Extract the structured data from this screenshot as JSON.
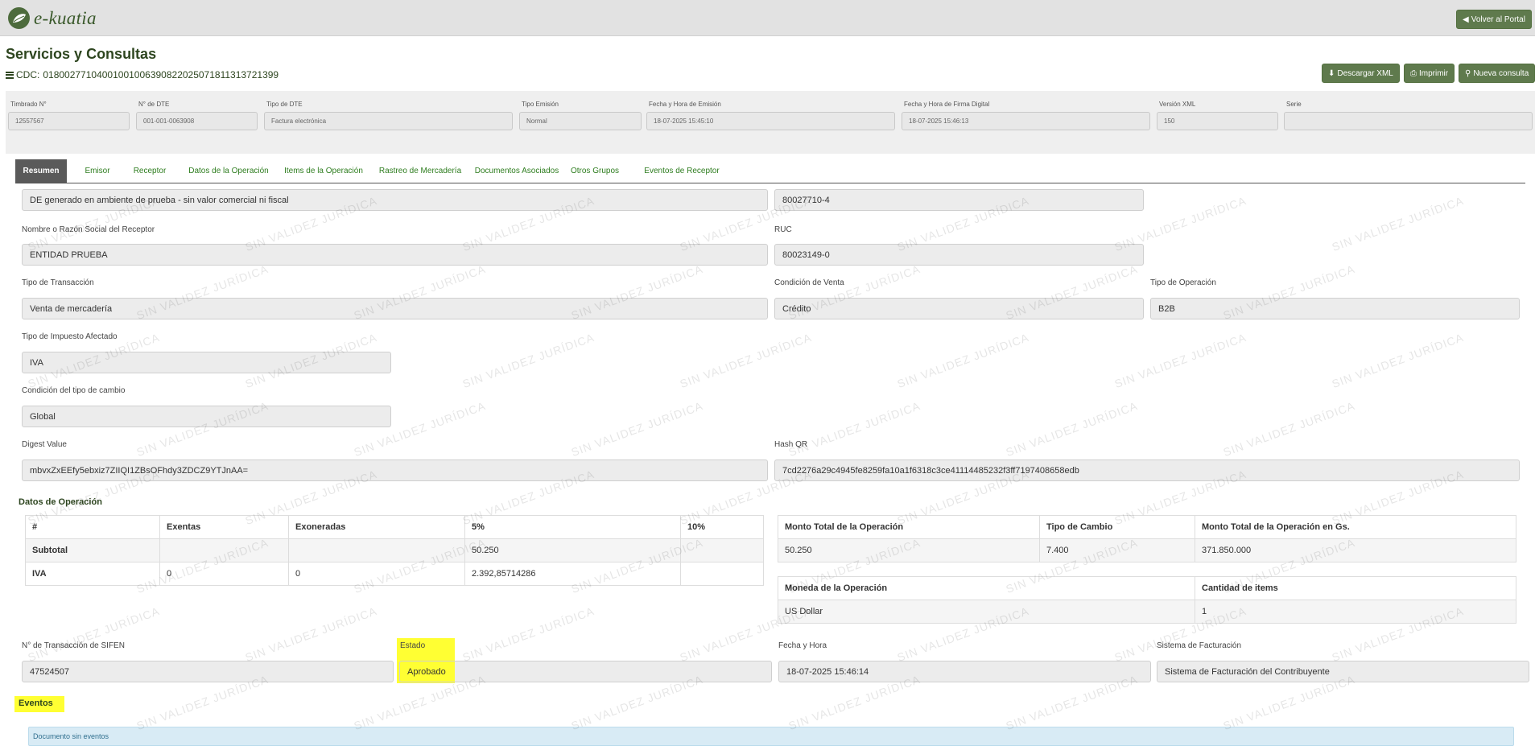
{
  "app": {
    "logo_text": "e-kuatia",
    "back_button": "Volver al Portal"
  },
  "page": {
    "title": "Servicios y Consultas",
    "cdc_label": "CDC:",
    "cdc_value": "01800277104001001006390822025071811313721399"
  },
  "actions": {
    "download_xml": "Descargar XML",
    "print": "Imprimir",
    "new_query": "Nueva consulta"
  },
  "header_fields": [
    {
      "label": "Timbrado N°",
      "value": "12557567"
    },
    {
      "label": "N° de DTE",
      "value": "001-001-0063908"
    },
    {
      "label": "Tipo de DTE",
      "value": "Factura electrónica"
    },
    {
      "label": "Tipo Emisión",
      "value": "Normal"
    },
    {
      "label": "Fecha y Hora de Emisión",
      "value": "18-07-2025 15:45:10"
    },
    {
      "label": "Fecha y Hora de Firma Digital",
      "value": "18-07-2025 15:46:13"
    },
    {
      "label": "Versión XML",
      "value": "150"
    },
    {
      "label": "Serie",
      "value": ""
    }
  ],
  "tabs": [
    "Resumen",
    "Emisor",
    "Receptor",
    "Datos de la Operación",
    "Items de la Operación",
    "Rastreo de Mercadería",
    "Documentos Asociados",
    "Otros Grupos",
    "Eventos de Receptor"
  ],
  "summary": {
    "de_note": "DE generado en ambiente de prueba - sin valor comercial ni fiscal",
    "emisor_ruc": "80027710-4",
    "receptor_name_label": "Nombre o Razón Social del Receptor",
    "receptor_name": "ENTIDAD PRUEBA",
    "ruc_label": "RUC",
    "ruc": "80023149-0",
    "tipo_transaccion_label": "Tipo de Transacción",
    "tipo_transaccion": "Venta de mercadería",
    "condicion_venta_label": "Condición de Venta",
    "condicion_venta": "Crédito",
    "tipo_operacion_label": "Tipo de Operación",
    "tipo_operacion": "B2B",
    "tipo_impuesto_label": "Tipo de Impuesto Afectado",
    "tipo_impuesto": "IVA",
    "condicion_cambio_label": "Condición del tipo de cambio",
    "condicion_cambio": "Global",
    "digest_label": "Digest Value",
    "digest": "mbvxZxEEfy5ebxiz7ZIIQI1ZBsOFhdy3ZDCZ9YTJnAA=",
    "hash_label": "Hash QR",
    "hash": "7cd2276a29c4945fe8259fa10a1f6318c3ce41114485232f3ff7197408658edb"
  },
  "operacion": {
    "title": "Datos de Operación",
    "headers": [
      "#",
      "Exentas",
      "Exoneradas",
      "5%",
      "10%"
    ],
    "rows": [
      [
        "Subtotal",
        "",
        "",
        "50.250",
        ""
      ],
      [
        "IVA",
        "0",
        "0",
        "2.392,85714286",
        ""
      ]
    ],
    "totals_headers": [
      "Monto Total de la Operación",
      "Tipo de Cambio",
      "Monto Total de la Operación en Gs."
    ],
    "totals_values": [
      "50.250",
      "7.400",
      "371.850.000"
    ],
    "moneda_headers": [
      "Moneda de la Operación",
      "Cantidad de items"
    ],
    "moneda_values": [
      "US Dollar",
      "1"
    ]
  },
  "sifen": {
    "trans_label": "N° de Transacción de SIFEN",
    "trans": "47524507",
    "estado_label": "Estado",
    "estado": "Aprobado",
    "fecha_label": "Fecha y Hora",
    "fecha": "18-07-2025 15:46:14",
    "sistema_label": "Sistema de Facturación",
    "sistema": "Sistema de Facturación del Contribuyente"
  },
  "eventos": {
    "title": "Eventos",
    "empty": "Documento sin eventos"
  },
  "watermark_text": "SIN VALIDEZ JURÍDICA",
  "colors": {
    "brand": "#5f7a4d",
    "title": "#2e4620",
    "tab_link": "#2e7d1f",
    "highlight": "#ffff33",
    "alert_bg": "#d8ebf5"
  }
}
